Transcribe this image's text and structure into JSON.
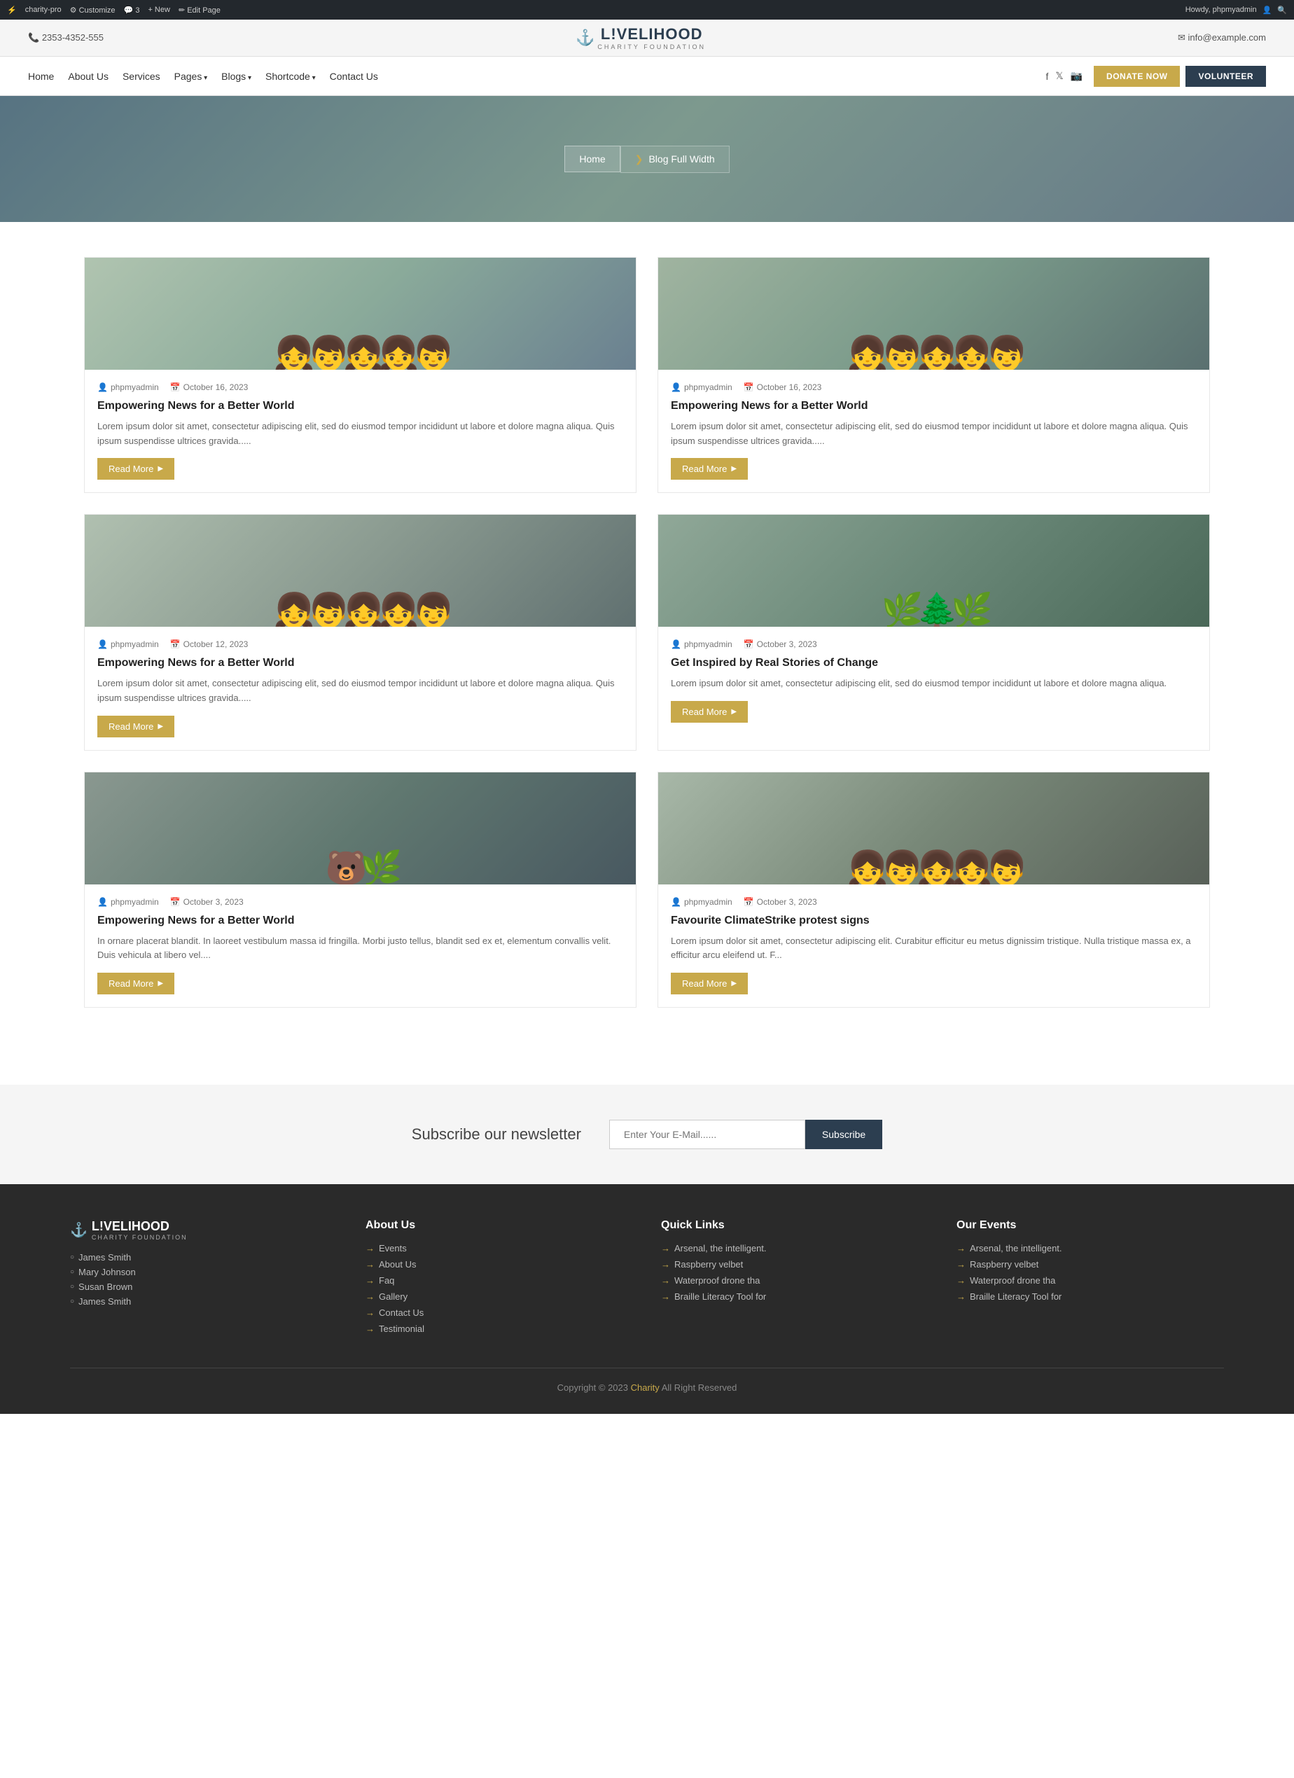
{
  "adminBar": {
    "left": [
      "charity-pro",
      "Customize",
      "3",
      "New",
      "Edit Page"
    ],
    "right": "Howdy, phpmyadmin"
  },
  "topBar": {
    "phone": "2353-4352-555",
    "email": "info@example.com",
    "logoLine1": "L!VELIHOOD",
    "logoLine2": "CHARITY FOUNDATION"
  },
  "nav": {
    "links": [
      "Home",
      "About Us",
      "Services",
      "Pages",
      "Blogs",
      "Shortcode",
      "Contact Us"
    ],
    "donateLabel": "DONATE NOW",
    "volunteerLabel": "VOLUNTEER"
  },
  "hero": {
    "breadcrumbHome": "Home",
    "breadcrumbCurrent": "Blog Full Width"
  },
  "blog": {
    "posts": [
      {
        "author": "phpmyadmin",
        "date": "October 16, 2023",
        "title": "Empowering News for a Better World",
        "excerpt": "Lorem ipsum dolor sit amet, consectetur adipiscing elit, sed do eiusmod tempor incididunt ut labore et dolore magna aliqua. Quis ipsum suspendisse ultrices gravida.....",
        "imageType": "children",
        "readMore": "Read More"
      },
      {
        "author": "phpmyadmin",
        "date": "October 16, 2023",
        "title": "Empowering News for a Better World",
        "excerpt": "Lorem ipsum dolor sit amet, consectetur adipiscing elit, sed do eiusmod tempor incididunt ut labore et dolore magna aliqua. Quis ipsum suspendisse ultrices gravida.....",
        "imageType": "children",
        "readMore": "Read More"
      },
      {
        "author": "phpmyadmin",
        "date": "October 12, 2023",
        "title": "Empowering News for a Better World",
        "excerpt": "Lorem ipsum dolor sit amet, consectetur adipiscing elit, sed do eiusmod tempor incididunt ut labore et dolore magna aliqua. Quis ipsum suspendisse ultrices gravida.....",
        "imageType": "children",
        "readMore": "Read More"
      },
      {
        "author": "phpmyadmin",
        "date": "October 3, 2023",
        "title": "Get Inspired by Real Stories of Change",
        "excerpt": "Lorem ipsum dolor sit amet, consectetur adipiscing elit, sed do eiusmod tempor incididunt ut labore et dolore magna aliqua.",
        "imageType": "nature",
        "readMore": "Read More"
      },
      {
        "author": "phpmyadmin",
        "date": "October 3, 2023",
        "title": "Empowering News for a Better World",
        "excerpt": "In ornare placerat blandit. In laoreet vestibulum massa id fringilla. Morbi justo tellus, blandit sed ex et, elementum convallis velit. Duis vehicula at libero vel....",
        "imageType": "bear",
        "readMore": "Read More"
      },
      {
        "author": "phpmyadmin",
        "date": "October 3, 2023",
        "title": "Favourite ClimateStrike protest signs",
        "excerpt": "Lorem ipsum dolor sit amet, consectetur adipiscing elit. Curabitur efficitur eu metus dignissim tristique. Nulla tristique massa ex, a efficitur arcu eleifend ut. F...",
        "imageType": "children2",
        "readMore": "Read More"
      }
    ]
  },
  "newsletter": {
    "title": "Subscribe our newsletter",
    "placeholder": "Enter Your E-Mail......",
    "buttonLabel": "Subscribe"
  },
  "footer": {
    "logoLine1": "L!VELIHOOD",
    "logoLine2": "CHARITY FOUNDATION",
    "authors": [
      "James Smith",
      "Mary Johnson",
      "Susan Brown",
      "James Smith"
    ],
    "aboutUs": {
      "title": "About Us",
      "links": [
        "Events",
        "About Us",
        "Faq",
        "Gallery",
        "Contact Us",
        "Testimonial"
      ]
    },
    "quickLinks": {
      "title": "Quick Links",
      "links": [
        "Arsenal, the intelligent.",
        "Raspberry velbet",
        "Waterproof drone tha",
        "Braille Literacy Tool for"
      ]
    },
    "ourEvents": {
      "title": "Our Events",
      "links": [
        "Arsenal, the intelligent.",
        "Raspberry velbet",
        "Waterproof drone tha",
        "Braille Literacy Tool for"
      ]
    },
    "copyright": "Copyright © 2023",
    "brandName": "Charity",
    "copyrightSuffix": " All Right Reserved"
  }
}
